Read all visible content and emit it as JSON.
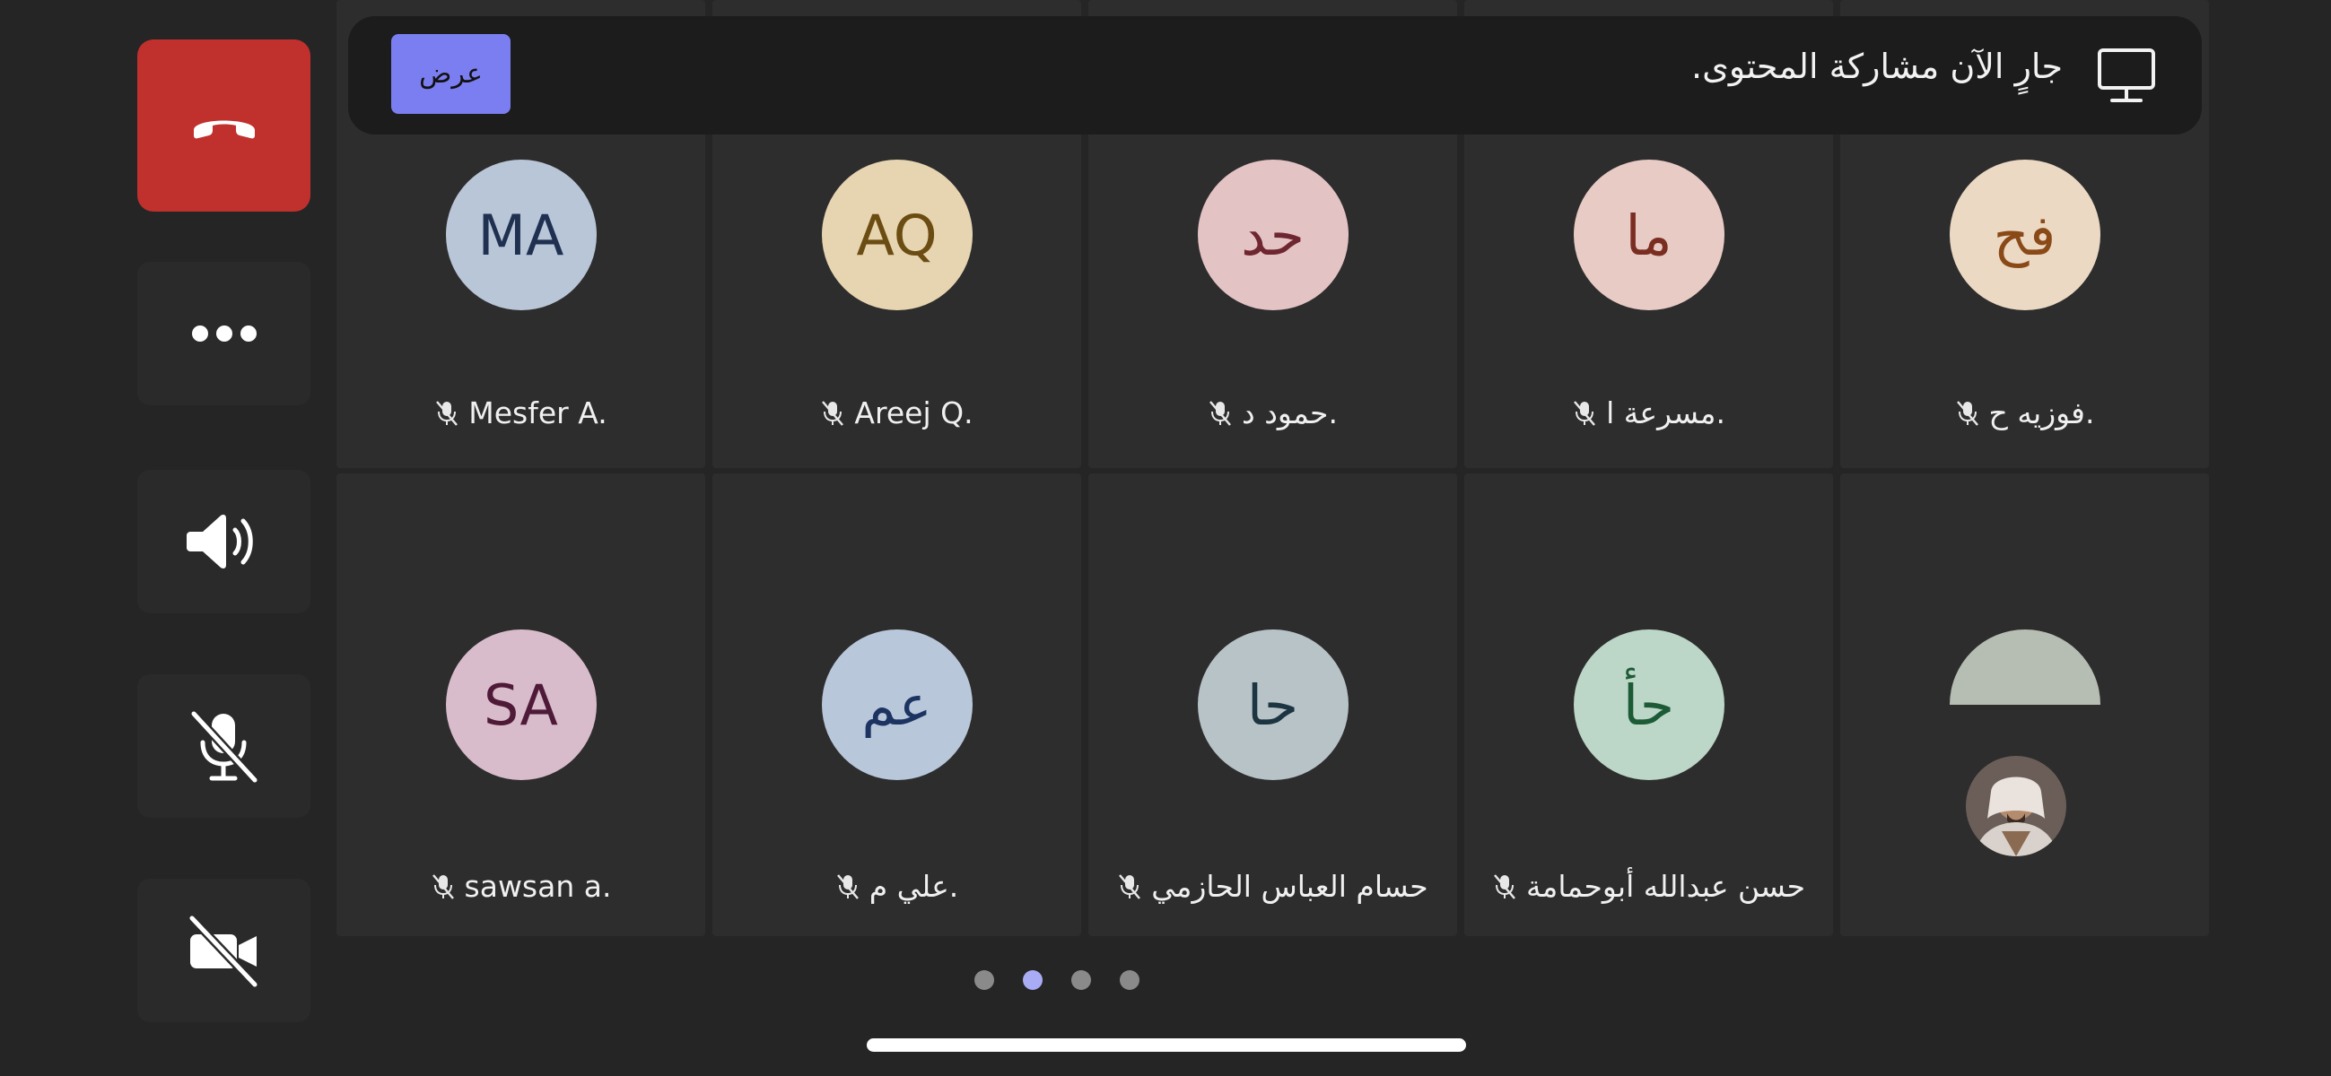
{
  "controls": {
    "end_call": "end-call",
    "more": "more",
    "speaker": "speaker",
    "mic": "mic-off",
    "video": "video-off"
  },
  "banner": {
    "message": "جارٍ الآن مشاركة المحتوى.",
    "view_button": "عرض"
  },
  "participants": [
    {
      "initials": "MA",
      "name": "Mesfer A.",
      "avatar_bg": "#b9c6d8",
      "text_color": "#1f3050"
    },
    {
      "initials": "AQ",
      "name": "Areej Q.",
      "avatar_bg": "#e7d5b1",
      "text_color": "#6b4c12"
    },
    {
      "initials": "حد",
      "name": "حمود د.",
      "avatar_bg": "#e4c3c5",
      "text_color": "#6e2630"
    },
    {
      "initials": "ما",
      "name": "مسرعة ا.",
      "avatar_bg": "#e8cbc4",
      "text_color": "#7a2e22"
    },
    {
      "initials": "فح",
      "name": "فوزيه ح.",
      "avatar_bg": "#ecd9c4",
      "text_color": "#8a4a18"
    },
    {
      "initials": "SA",
      "name": "sawsan a.",
      "avatar_bg": "#d9bccb",
      "text_color": "#4f1a38"
    },
    {
      "initials": "عم",
      "name": "علي م.",
      "avatar_bg": "#b8c7da",
      "text_color": "#1d3462"
    },
    {
      "initials": "حا",
      "name": "حسام العباس الحازمي",
      "avatar_bg": "#b8c3c8",
      "text_color": "#1d3540"
    },
    {
      "initials": "حأ",
      "name": "حسن عبدالله أبوحمامة",
      "avatar_bg": "#bcd6c8",
      "text_color": "#1d5a36"
    }
  ],
  "pagination": {
    "pages": 4,
    "active": 2
  }
}
